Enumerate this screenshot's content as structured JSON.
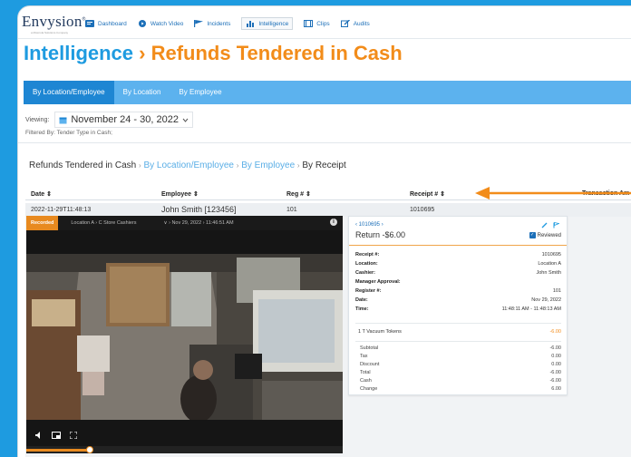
{
  "brand": {
    "name": "Envysion",
    "mark": "®",
    "tagline": "a Motorola Solutions Company"
  },
  "nav": [
    {
      "label": "Dashboard",
      "icon": "dashboard-icon"
    },
    {
      "label": "Watch Video",
      "icon": "play-icon"
    },
    {
      "label": "Incidents",
      "icon": "flag-icon"
    },
    {
      "label": "Intelligence",
      "icon": "bar-chart-icon",
      "active": true
    },
    {
      "label": "Clips",
      "icon": "film-icon"
    },
    {
      "label": "Audits",
      "icon": "pencil-icon"
    }
  ],
  "page": {
    "title_section": "Intelligence",
    "title_sep": " › ",
    "title_report": "Refunds Tendered in Cash"
  },
  "tabs": [
    {
      "label": "By Location/Employee",
      "active": true
    },
    {
      "label": "By Location"
    },
    {
      "label": "By Employee"
    }
  ],
  "viewing": {
    "label": "Viewing:",
    "range": "November 24 - 30, 2022"
  },
  "filtered": {
    "label": "Filtered By:",
    "value": "Tender Type in Cash;"
  },
  "breadcrumb": {
    "root": "Refunds Tendered in Cash",
    "level1": "By Location/Employee",
    "level2": "By Employee",
    "current": "By Receipt",
    "sep": "›"
  },
  "table": {
    "headers": [
      "Date ⇕",
      "Employee ⇕",
      "Reg # ⇕",
      "Receipt # ⇕",
      "Transaction Am"
    ],
    "row": {
      "date": "2022-11-29T11:48:13",
      "employee": "John Smith [123456]",
      "reg": "101",
      "receipt": "1010695"
    }
  },
  "video": {
    "status": "Recorded",
    "location": "Location A  ›  C Store Cashiers",
    "timestamp": "∨  › Nov 29, 2022 › 11:46:51 AM",
    "info": "i",
    "progress": 0.2
  },
  "receipt": {
    "number_nav": "‹ 1010695 ›",
    "type": "Return -$6.00",
    "reviewed_label": "Reviewed",
    "reviewed": true,
    "fields": [
      {
        "k": "Receipt #:",
        "v": "1010695"
      },
      {
        "k": "Location:",
        "v": "Location A"
      },
      {
        "k": "Cashier:",
        "v": "John Smith"
      },
      {
        "k": "Manager Approval:",
        "v": ""
      },
      {
        "k": "Register #:",
        "v": "101"
      },
      {
        "k": "Date:",
        "v": "Nov 29, 2022"
      },
      {
        "k": "Time:",
        "v": "11:48:11 AM - 11:48:13 AM"
      }
    ],
    "item": {
      "label": "1   T Vacuum Tokens",
      "amount": "-6.00"
    },
    "totals": [
      {
        "k": "Subtotal",
        "v": "-6.00",
        "neg": true
      },
      {
        "k": "Tax",
        "v": "0.00"
      },
      {
        "k": "Discount",
        "v": "0.00"
      },
      {
        "k": "Total",
        "v": "-6.00",
        "neg": true
      },
      {
        "k": "Cash",
        "v": "-6.00",
        "neg": true
      },
      {
        "k": "Change",
        "v": "6.00"
      }
    ]
  },
  "colors": {
    "brand_blue": "#1e9be0",
    "accent_orange": "#f28c1a",
    "tab_bar": "#5cb2ee"
  }
}
